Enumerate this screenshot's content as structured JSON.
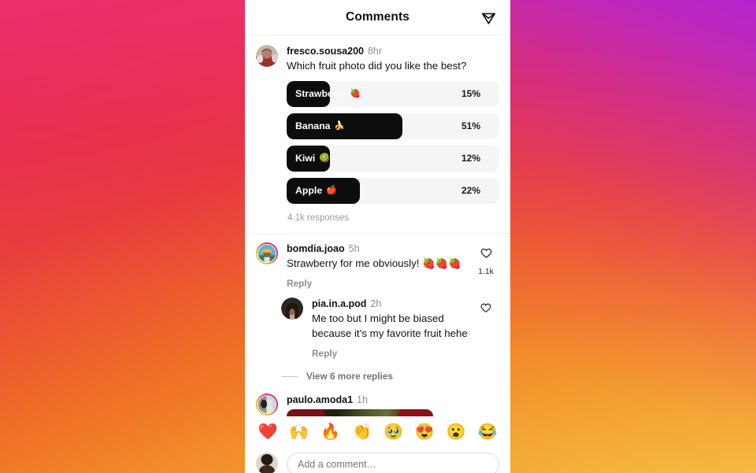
{
  "background": {
    "gradient_colors": [
      "#b425ce",
      "#d12a8c",
      "#e8334f",
      "#ef7124",
      "#f5c043"
    ],
    "description": "instagram-brand-gradient"
  },
  "header": {
    "title": "Comments",
    "send_icon": "send-paper-plane-icon"
  },
  "poll_post": {
    "username": "fresco.sousa200",
    "time": "8hr",
    "question": "Which fruit photo did you like the best?",
    "responses_label": "4.1k responses",
    "options": [
      {
        "label": "Strawberry",
        "emoji": "🍓",
        "percent": "15%",
        "value": 15,
        "fill_ratio": 0.205
      },
      {
        "label": "Banana",
        "emoji": "🍌",
        "percent": "51%",
        "value": 51,
        "fill_ratio": 0.545
      },
      {
        "label": "Kiwi",
        "emoji": "🥝",
        "percent": "12%",
        "value": 12,
        "fill_ratio": 0.205
      },
      {
        "label": "Apple",
        "emoji": "🍎",
        "percent": "22%",
        "value": 22,
        "fill_ratio": 0.345
      }
    ]
  },
  "comments": [
    {
      "username": "bomdia.joao",
      "time": "5h",
      "text": "Strawberry for me obviously! 🍓🍓🍓",
      "reply_label": "Reply",
      "like_count": "1.1k",
      "like_icon": "heart-outline-icon"
    },
    {
      "username": "pia.in.a.pod",
      "time": "2h",
      "text": "Me too but I might be biased because it’s my favorite fruit hehe",
      "reply_label": "Reply",
      "like_count": "",
      "like_icon": "heart-outline-icon"
    }
  ],
  "more_replies": {
    "label": "View 6 more replies"
  },
  "last_comment": {
    "username": "paulo.amoda1",
    "time": "1h",
    "attachment": "image-attachment-thumbnail"
  },
  "emoji_bar": {
    "emojis": [
      "❤️",
      "🙌",
      "🔥",
      "👏",
      "🥹",
      "😍",
      "😮",
      "😂"
    ],
    "names": [
      "red-heart-emoji",
      "raising-hands-emoji",
      "fire-emoji",
      "clapping-hands-emoji",
      "holding-back-tears-emoji",
      "heart-eyes-emoji",
      "surprised-face-emoji",
      "tears-of-joy-emoji"
    ]
  },
  "composer": {
    "placeholder": "Add a comment…",
    "value": ""
  }
}
